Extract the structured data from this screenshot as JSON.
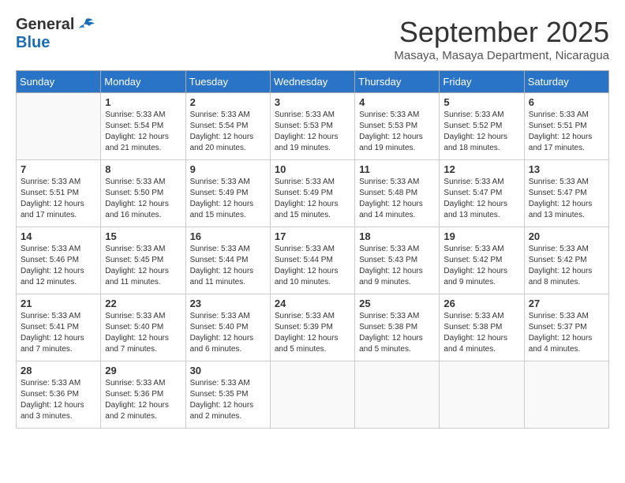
{
  "header": {
    "logo_general": "General",
    "logo_blue": "Blue",
    "month": "September 2025",
    "location": "Masaya, Masaya Department, Nicaragua"
  },
  "weekdays": [
    "Sunday",
    "Monday",
    "Tuesday",
    "Wednesday",
    "Thursday",
    "Friday",
    "Saturday"
  ],
  "weeks": [
    [
      {
        "day": "",
        "info": ""
      },
      {
        "day": "1",
        "info": "Sunrise: 5:33 AM\nSunset: 5:54 PM\nDaylight: 12 hours\nand 21 minutes."
      },
      {
        "day": "2",
        "info": "Sunrise: 5:33 AM\nSunset: 5:54 PM\nDaylight: 12 hours\nand 20 minutes."
      },
      {
        "day": "3",
        "info": "Sunrise: 5:33 AM\nSunset: 5:53 PM\nDaylight: 12 hours\nand 19 minutes."
      },
      {
        "day": "4",
        "info": "Sunrise: 5:33 AM\nSunset: 5:53 PM\nDaylight: 12 hours\nand 19 minutes."
      },
      {
        "day": "5",
        "info": "Sunrise: 5:33 AM\nSunset: 5:52 PM\nDaylight: 12 hours\nand 18 minutes."
      },
      {
        "day": "6",
        "info": "Sunrise: 5:33 AM\nSunset: 5:51 PM\nDaylight: 12 hours\nand 17 minutes."
      }
    ],
    [
      {
        "day": "7",
        "info": "Sunrise: 5:33 AM\nSunset: 5:51 PM\nDaylight: 12 hours\nand 17 minutes."
      },
      {
        "day": "8",
        "info": "Sunrise: 5:33 AM\nSunset: 5:50 PM\nDaylight: 12 hours\nand 16 minutes."
      },
      {
        "day": "9",
        "info": "Sunrise: 5:33 AM\nSunset: 5:49 PM\nDaylight: 12 hours\nand 15 minutes."
      },
      {
        "day": "10",
        "info": "Sunrise: 5:33 AM\nSunset: 5:49 PM\nDaylight: 12 hours\nand 15 minutes."
      },
      {
        "day": "11",
        "info": "Sunrise: 5:33 AM\nSunset: 5:48 PM\nDaylight: 12 hours\nand 14 minutes."
      },
      {
        "day": "12",
        "info": "Sunrise: 5:33 AM\nSunset: 5:47 PM\nDaylight: 12 hours\nand 13 minutes."
      },
      {
        "day": "13",
        "info": "Sunrise: 5:33 AM\nSunset: 5:47 PM\nDaylight: 12 hours\nand 13 minutes."
      }
    ],
    [
      {
        "day": "14",
        "info": "Sunrise: 5:33 AM\nSunset: 5:46 PM\nDaylight: 12 hours\nand 12 minutes."
      },
      {
        "day": "15",
        "info": "Sunrise: 5:33 AM\nSunset: 5:45 PM\nDaylight: 12 hours\nand 11 minutes."
      },
      {
        "day": "16",
        "info": "Sunrise: 5:33 AM\nSunset: 5:44 PM\nDaylight: 12 hours\nand 11 minutes."
      },
      {
        "day": "17",
        "info": "Sunrise: 5:33 AM\nSunset: 5:44 PM\nDaylight: 12 hours\nand 10 minutes."
      },
      {
        "day": "18",
        "info": "Sunrise: 5:33 AM\nSunset: 5:43 PM\nDaylight: 12 hours\nand 9 minutes."
      },
      {
        "day": "19",
        "info": "Sunrise: 5:33 AM\nSunset: 5:42 PM\nDaylight: 12 hours\nand 9 minutes."
      },
      {
        "day": "20",
        "info": "Sunrise: 5:33 AM\nSunset: 5:42 PM\nDaylight: 12 hours\nand 8 minutes."
      }
    ],
    [
      {
        "day": "21",
        "info": "Sunrise: 5:33 AM\nSunset: 5:41 PM\nDaylight: 12 hours\nand 7 minutes."
      },
      {
        "day": "22",
        "info": "Sunrise: 5:33 AM\nSunset: 5:40 PM\nDaylight: 12 hours\nand 7 minutes."
      },
      {
        "day": "23",
        "info": "Sunrise: 5:33 AM\nSunset: 5:40 PM\nDaylight: 12 hours\nand 6 minutes."
      },
      {
        "day": "24",
        "info": "Sunrise: 5:33 AM\nSunset: 5:39 PM\nDaylight: 12 hours\nand 5 minutes."
      },
      {
        "day": "25",
        "info": "Sunrise: 5:33 AM\nSunset: 5:38 PM\nDaylight: 12 hours\nand 5 minutes."
      },
      {
        "day": "26",
        "info": "Sunrise: 5:33 AM\nSunset: 5:38 PM\nDaylight: 12 hours\nand 4 minutes."
      },
      {
        "day": "27",
        "info": "Sunrise: 5:33 AM\nSunset: 5:37 PM\nDaylight: 12 hours\nand 4 minutes."
      }
    ],
    [
      {
        "day": "28",
        "info": "Sunrise: 5:33 AM\nSunset: 5:36 PM\nDaylight: 12 hours\nand 3 minutes."
      },
      {
        "day": "29",
        "info": "Sunrise: 5:33 AM\nSunset: 5:36 PM\nDaylight: 12 hours\nand 2 minutes."
      },
      {
        "day": "30",
        "info": "Sunrise: 5:33 AM\nSunset: 5:35 PM\nDaylight: 12 hours\nand 2 minutes."
      },
      {
        "day": "",
        "info": ""
      },
      {
        "day": "",
        "info": ""
      },
      {
        "day": "",
        "info": ""
      },
      {
        "day": "",
        "info": ""
      }
    ]
  ]
}
